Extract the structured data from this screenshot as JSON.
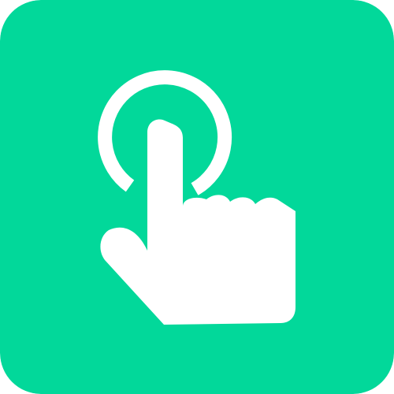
{
  "icon": {
    "name": "tap-gesture-icon",
    "colors": {
      "background": "#02D89A",
      "foreground": "#FFFFFF"
    }
  }
}
